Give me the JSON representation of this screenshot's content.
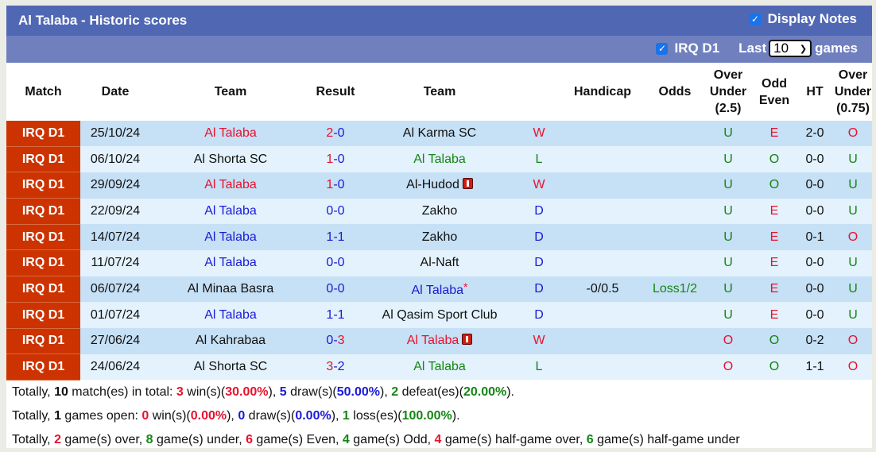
{
  "header": {
    "title": "Al Talaba - Historic scores",
    "display_notes_label": "Display Notes",
    "display_notes_checked": true
  },
  "filters": {
    "league_label": "IRQ D1",
    "league_checked": true,
    "last_label": "Last",
    "games_count": "10",
    "games_label": "games"
  },
  "columns": {
    "match": "Match",
    "date": "Date",
    "home": "Team",
    "result": "Result",
    "away": "Team",
    "handicap": "Handicap",
    "odds": "Odds",
    "ou_line1": "Over",
    "ou_line2": "Under",
    "ou_line3": "(2.5)",
    "oe_line1": "Odd",
    "oe_line2": "Even",
    "ht": "HT",
    "ou75_line1": "Over",
    "ou75_line2": "Under",
    "ou75_line3": "(0.75)"
  },
  "colors": {
    "header_bg": "#5068b3",
    "filter_bg": "#7080bf",
    "league_bg": "#cc3300",
    "row_odd": "#c6e0f5",
    "row_even": "#e3f2fc",
    "red": "#e8112d",
    "blue": "#1a1ad6",
    "green": "#148514"
  },
  "rows": [
    {
      "league": "IRQ D1",
      "date": "25/10/24",
      "home": "Al Talaba",
      "home_color": "red",
      "home_card": false,
      "score_home": "2",
      "score_home_color": "red",
      "score_away": "0",
      "score_away_color": "blue",
      "away": "Al Karma SC",
      "away_color": "black",
      "away_card": false,
      "away_star": false,
      "wl": "W",
      "wl_color": "red",
      "handicap": "",
      "odds": "",
      "odds_color": "green",
      "ou": "U",
      "ou_color": "green",
      "oe": "E",
      "oe_color": "red",
      "ht": "2-0",
      "ou75": "O",
      "ou75_color": "red"
    },
    {
      "league": "IRQ D1",
      "date": "06/10/24",
      "home": "Al Shorta SC",
      "home_color": "black",
      "home_card": false,
      "score_home": "1",
      "score_home_color": "red",
      "score_away": "0",
      "score_away_color": "blue",
      "away": "Al Talaba",
      "away_color": "green",
      "away_card": false,
      "away_star": false,
      "wl": "L",
      "wl_color": "green",
      "handicap": "",
      "odds": "",
      "odds_color": "green",
      "ou": "U",
      "ou_color": "green",
      "oe": "O",
      "oe_color": "green",
      "ht": "0-0",
      "ou75": "U",
      "ou75_color": "green"
    },
    {
      "league": "IRQ D1",
      "date": "29/09/24",
      "home": "Al Talaba",
      "home_color": "red",
      "home_card": false,
      "score_home": "1",
      "score_home_color": "red",
      "score_away": "0",
      "score_away_color": "blue",
      "away": "Al-Hudod",
      "away_color": "black",
      "away_card": true,
      "away_star": false,
      "wl": "W",
      "wl_color": "red",
      "handicap": "",
      "odds": "",
      "odds_color": "green",
      "ou": "U",
      "ou_color": "green",
      "oe": "O",
      "oe_color": "green",
      "ht": "0-0",
      "ou75": "U",
      "ou75_color": "green"
    },
    {
      "league": "IRQ D1",
      "date": "22/09/24",
      "home": "Al Talaba",
      "home_color": "blue",
      "home_card": false,
      "score_home": "0",
      "score_home_color": "blue",
      "score_away": "0",
      "score_away_color": "blue",
      "away": "Zakho",
      "away_color": "black",
      "away_card": false,
      "away_star": false,
      "wl": "D",
      "wl_color": "blue",
      "handicap": "",
      "odds": "",
      "odds_color": "green",
      "ou": "U",
      "ou_color": "green",
      "oe": "E",
      "oe_color": "red",
      "ht": "0-0",
      "ou75": "U",
      "ou75_color": "green"
    },
    {
      "league": "IRQ D1",
      "date": "14/07/24",
      "home": "Al Talaba",
      "home_color": "blue",
      "home_card": false,
      "score_home": "1",
      "score_home_color": "blue",
      "score_away": "1",
      "score_away_color": "blue",
      "away": "Zakho",
      "away_color": "black",
      "away_card": false,
      "away_star": false,
      "wl": "D",
      "wl_color": "blue",
      "handicap": "",
      "odds": "",
      "odds_color": "green",
      "ou": "U",
      "ou_color": "green",
      "oe": "E",
      "oe_color": "red",
      "ht": "0-1",
      "ou75": "O",
      "ou75_color": "red"
    },
    {
      "league": "IRQ D1",
      "date": "11/07/24",
      "home": "Al Talaba",
      "home_color": "blue",
      "home_card": false,
      "score_home": "0",
      "score_home_color": "blue",
      "score_away": "0",
      "score_away_color": "blue",
      "away": "Al-Naft",
      "away_color": "black",
      "away_card": false,
      "away_star": false,
      "wl": "D",
      "wl_color": "blue",
      "handicap": "",
      "odds": "",
      "odds_color": "green",
      "ou": "U",
      "ou_color": "green",
      "oe": "E",
      "oe_color": "red",
      "ht": "0-0",
      "ou75": "U",
      "ou75_color": "green"
    },
    {
      "league": "IRQ D1",
      "date": "06/07/24",
      "home": "Al Minaa Basra",
      "home_color": "black",
      "home_card": false,
      "score_home": "0",
      "score_home_color": "blue",
      "score_away": "0",
      "score_away_color": "blue",
      "away": "Al Talaba",
      "away_color": "blue",
      "away_card": false,
      "away_star": true,
      "wl": "D",
      "wl_color": "blue",
      "handicap": "-0/0.5",
      "odds": "Loss1/2",
      "odds_color": "green",
      "ou": "U",
      "ou_color": "green",
      "oe": "E",
      "oe_color": "red",
      "ht": "0-0",
      "ou75": "U",
      "ou75_color": "green"
    },
    {
      "league": "IRQ D1",
      "date": "01/07/24",
      "home": "Al Talaba",
      "home_color": "blue",
      "home_card": false,
      "score_home": "1",
      "score_home_color": "blue",
      "score_away": "1",
      "score_away_color": "blue",
      "away": "Al Qasim Sport Club",
      "away_color": "black",
      "away_card": false,
      "away_star": false,
      "wl": "D",
      "wl_color": "blue",
      "handicap": "",
      "odds": "",
      "odds_color": "green",
      "ou": "U",
      "ou_color": "green",
      "oe": "E",
      "oe_color": "red",
      "ht": "0-0",
      "ou75": "U",
      "ou75_color": "green"
    },
    {
      "league": "IRQ D1",
      "date": "27/06/24",
      "home": "Al Kahrabaa",
      "home_color": "black",
      "home_card": false,
      "score_home": "0",
      "score_home_color": "blue",
      "score_away": "3",
      "score_away_color": "red",
      "away": "Al Talaba",
      "away_color": "red",
      "away_card": true,
      "away_star": false,
      "wl": "W",
      "wl_color": "red",
      "handicap": "",
      "odds": "",
      "odds_color": "green",
      "ou": "O",
      "ou_color": "red",
      "oe": "O",
      "oe_color": "green",
      "ht": "0-2",
      "ou75": "O",
      "ou75_color": "red"
    },
    {
      "league": "IRQ D1",
      "date": "24/06/24",
      "home": "Al Shorta SC",
      "home_color": "black",
      "home_card": false,
      "score_home": "3",
      "score_home_color": "red",
      "score_away": "2",
      "score_away_color": "blue",
      "away": "Al Talaba",
      "away_color": "green",
      "away_card": false,
      "away_star": false,
      "wl": "L",
      "wl_color": "green",
      "handicap": "",
      "odds": "",
      "odds_color": "green",
      "ou": "O",
      "ou_color": "red",
      "oe": "O",
      "oe_color": "green",
      "ht": "1-1",
      "ou75": "O",
      "ou75_color": "red"
    }
  ],
  "summary": {
    "line1": [
      {
        "t": "Totally, ",
        "c": ""
      },
      {
        "t": "10",
        "c": "b"
      },
      {
        "t": " match(es) in total: ",
        "c": ""
      },
      {
        "t": "3",
        "c": "red"
      },
      {
        "t": " win(s)(",
        "c": ""
      },
      {
        "t": "30.00%",
        "c": "red"
      },
      {
        "t": "), ",
        "c": ""
      },
      {
        "t": "5",
        "c": "blue"
      },
      {
        "t": " draw(s)(",
        "c": ""
      },
      {
        "t": "50.00%",
        "c": "blue"
      },
      {
        "t": "), ",
        "c": ""
      },
      {
        "t": "2",
        "c": "green"
      },
      {
        "t": " defeat(es)(",
        "c": ""
      },
      {
        "t": "20.00%",
        "c": "green"
      },
      {
        "t": ").",
        "c": ""
      }
    ],
    "line2": [
      {
        "t": "Totally, ",
        "c": ""
      },
      {
        "t": "1",
        "c": "b"
      },
      {
        "t": " games open: ",
        "c": ""
      },
      {
        "t": "0",
        "c": "red"
      },
      {
        "t": " win(s)(",
        "c": ""
      },
      {
        "t": "0.00%",
        "c": "red"
      },
      {
        "t": "), ",
        "c": ""
      },
      {
        "t": "0",
        "c": "blue"
      },
      {
        "t": " draw(s)(",
        "c": ""
      },
      {
        "t": "0.00%",
        "c": "blue"
      },
      {
        "t": "), ",
        "c": ""
      },
      {
        "t": "1",
        "c": "green"
      },
      {
        "t": " loss(es)(",
        "c": ""
      },
      {
        "t": "100.00%",
        "c": "green"
      },
      {
        "t": ").",
        "c": ""
      }
    ],
    "line3": [
      {
        "t": "Totally, ",
        "c": ""
      },
      {
        "t": "2",
        "c": "red"
      },
      {
        "t": " game(s) over, ",
        "c": ""
      },
      {
        "t": "8",
        "c": "green"
      },
      {
        "t": " game(s) under, ",
        "c": ""
      },
      {
        "t": "6",
        "c": "red"
      },
      {
        "t": " game(s) Even, ",
        "c": ""
      },
      {
        "t": "4",
        "c": "green"
      },
      {
        "t": " game(s) Odd, ",
        "c": ""
      },
      {
        "t": "4",
        "c": "red"
      },
      {
        "t": " game(s) half-game over, ",
        "c": ""
      },
      {
        "t": "6",
        "c": "green"
      },
      {
        "t": " game(s) half-game under",
        "c": ""
      }
    ]
  }
}
